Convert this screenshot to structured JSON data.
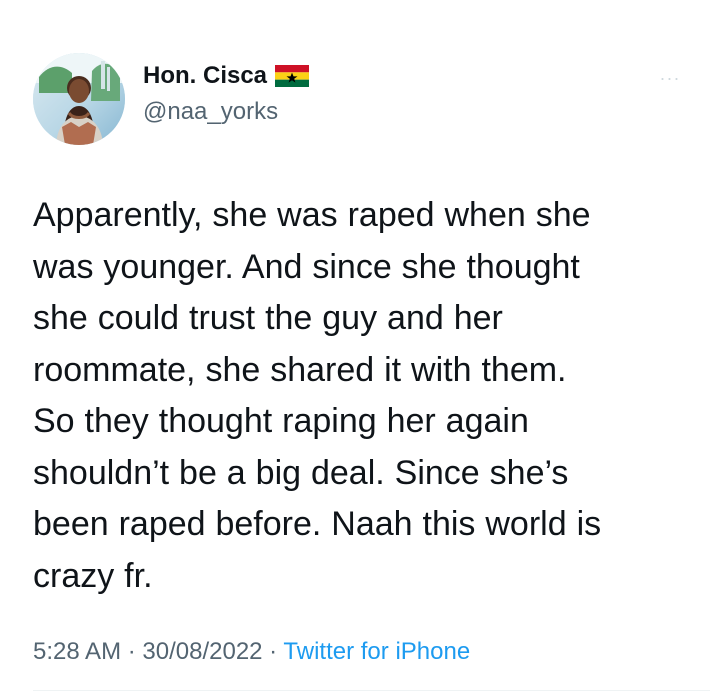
{
  "author": {
    "display_name": "Hon. Cisca",
    "handle": "@naa_yorks",
    "flag_icon": "ghana-flag-icon"
  },
  "menu": {
    "more_icon": "more-options-icon",
    "more_glyph": "···"
  },
  "tweet": {
    "lines": [
      "Apparently, she was raped when she",
      "was younger. And since she thought",
      "she could trust the guy and her",
      "roommate, she shared it with them.",
      "So they thought raping her again",
      "shouldn’t be a big deal. Since she’s",
      "been raped before. Naah this world is",
      "crazy fr."
    ],
    "time": "5:28 AM",
    "separator1": " · ",
    "date": "30/08/2022",
    "separator2": " · ",
    "source": "Twitter for iPhone"
  },
  "colors": {
    "text_primary": "#0f1419",
    "text_secondary": "#536471",
    "link": "#1d9bf0",
    "divider": "#eff3f4",
    "flag_red": "#ce1126",
    "flag_gold": "#fcd116",
    "flag_green": "#006b3f",
    "flag_star": "#000000"
  }
}
